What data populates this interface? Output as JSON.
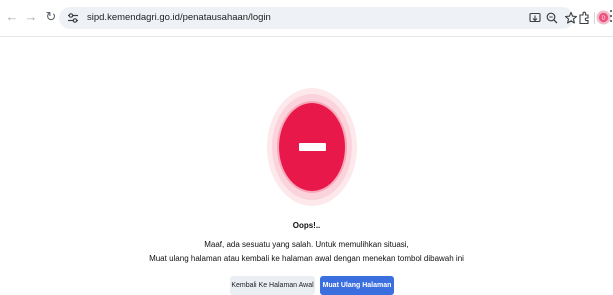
{
  "browser": {
    "url": "sipd.kemendagri.go.id/penatausahaan/login",
    "profile_initial": "D"
  },
  "icons": {
    "back": "arrow-left-icon",
    "forward": "arrow-right-icon",
    "reload": "reload-icon",
    "site_info": "site-settings-icon",
    "install": "install-app-icon",
    "zoom": "zoom-icon",
    "bookmark": "star-icon",
    "extensions": "extensions-icon",
    "menu": "kebab-menu-icon"
  },
  "error": {
    "title": "Oops!..",
    "message_line1": "Maaf, ada sesuatu yang salah. Untuk memulihkan situasi,",
    "message_line2": "Muat ulang halaman atau kembali ke halaman awal dengan menekan tombol dibawah ini"
  },
  "actions": {
    "home_label": "Kembali Ke Halaman Awal",
    "reload_label": "Muat Ulang Halaman"
  },
  "colors": {
    "error_red": "#e8194a",
    "ring_light": "#fcd4dc",
    "primary_button": "#3b6fe0",
    "secondary_button": "#ebeef3"
  }
}
